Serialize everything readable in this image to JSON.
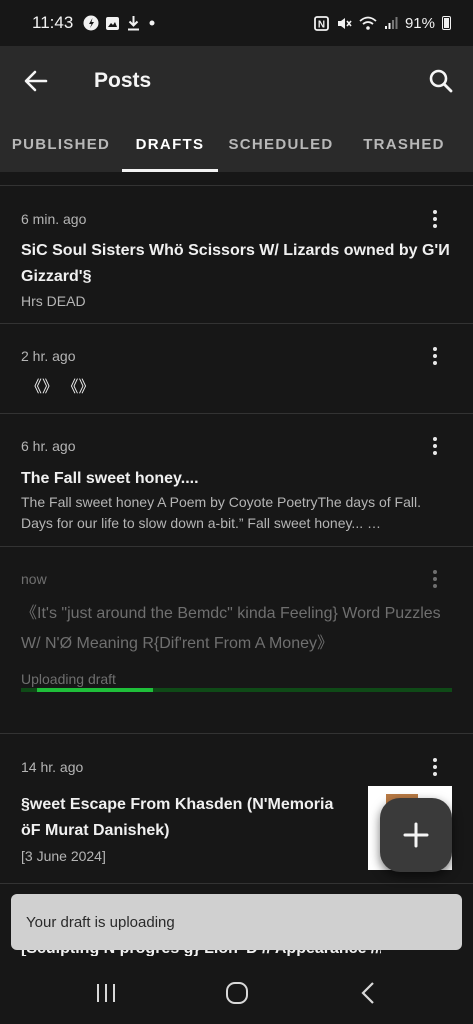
{
  "status_bar": {
    "time": "11:43",
    "battery": "91%",
    "icons": [
      "threads-icon",
      "image-icon",
      "download-icon",
      "dot-icon",
      "nfc-icon",
      "mute-icon",
      "wifi-icon",
      "signal-icon",
      "battery-icon"
    ]
  },
  "app_bar": {
    "title": "Posts",
    "back_icon": "arrow-left-icon",
    "search_icon": "search-icon"
  },
  "tabs": [
    {
      "label": "PUBLISHED",
      "active": false
    },
    {
      "label": "DRAFTS",
      "active": true
    },
    {
      "label": "SCHEDULED",
      "active": false
    },
    {
      "label": "TRASHED",
      "active": false
    }
  ],
  "posts": [
    {
      "time": "6 min. ago",
      "title": "SiC Soul Sisters Whö Scissors W/ Lizards owned by G'И Gizzard'§",
      "excerpt": "Hrs DEAD"
    },
    {
      "time": "2 hr. ago",
      "title": "《》 《》",
      "excerpt": ""
    },
    {
      "time": "6 hr. ago",
      "title": "The Fall sweet honey....",
      "excerpt": "The Fall sweet honey A Poem by Coyote PoetryThe days of Fall. Days for our life to slow down a-bit.” Fall sweet honey... …"
    },
    {
      "time": "now",
      "title": "《It's \"just around the Bemdc\" kinda Feeling} Word Puzzles W/ N'Ø Meaning R{Dif'rent From A Money》",
      "status": "Uploading draft",
      "progress": 0.27
    },
    {
      "time": "14 hr. ago",
      "title": "§weet Escape From Khasden (N'Memoria öF Murat Danishek)",
      "excerpt": "[3 June 2024]"
    }
  ],
  "partial_post_title": "[Sculpting N progres g} Lion' D // Appearance ///",
  "snackbar": {
    "text": "Your draft is uploading"
  },
  "fab": {
    "icon": "plus-icon"
  },
  "nav": {
    "recents_icon": "recents-icon",
    "home_icon": "home-icon",
    "back_icon": "back-chevron-icon"
  },
  "colors": {
    "accent_progress": "#1fbf3a",
    "progress_track": "#0f4a17",
    "app_bar": "#2a2a2a",
    "background": "#171717"
  }
}
